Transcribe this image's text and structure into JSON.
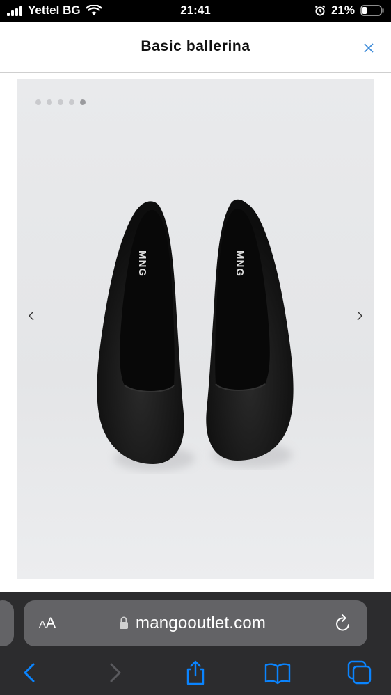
{
  "status_bar": {
    "carrier": "Yettel BG",
    "time": "21:41",
    "battery": "21%"
  },
  "header": {
    "title": "Basic ballerina",
    "close_icon": "close-icon"
  },
  "gallery": {
    "dot_count": 5,
    "active_dot": 4,
    "prev_icon": "chevron-left-icon",
    "next_icon": "chevron-right-icon",
    "insole_brand": "MNG",
    "shoe_color": "#151515"
  },
  "browser": {
    "text_size_label_small": "A",
    "text_size_label_large": "A",
    "url": "mangooutlet.com",
    "accent_color": "#0a84ff"
  }
}
